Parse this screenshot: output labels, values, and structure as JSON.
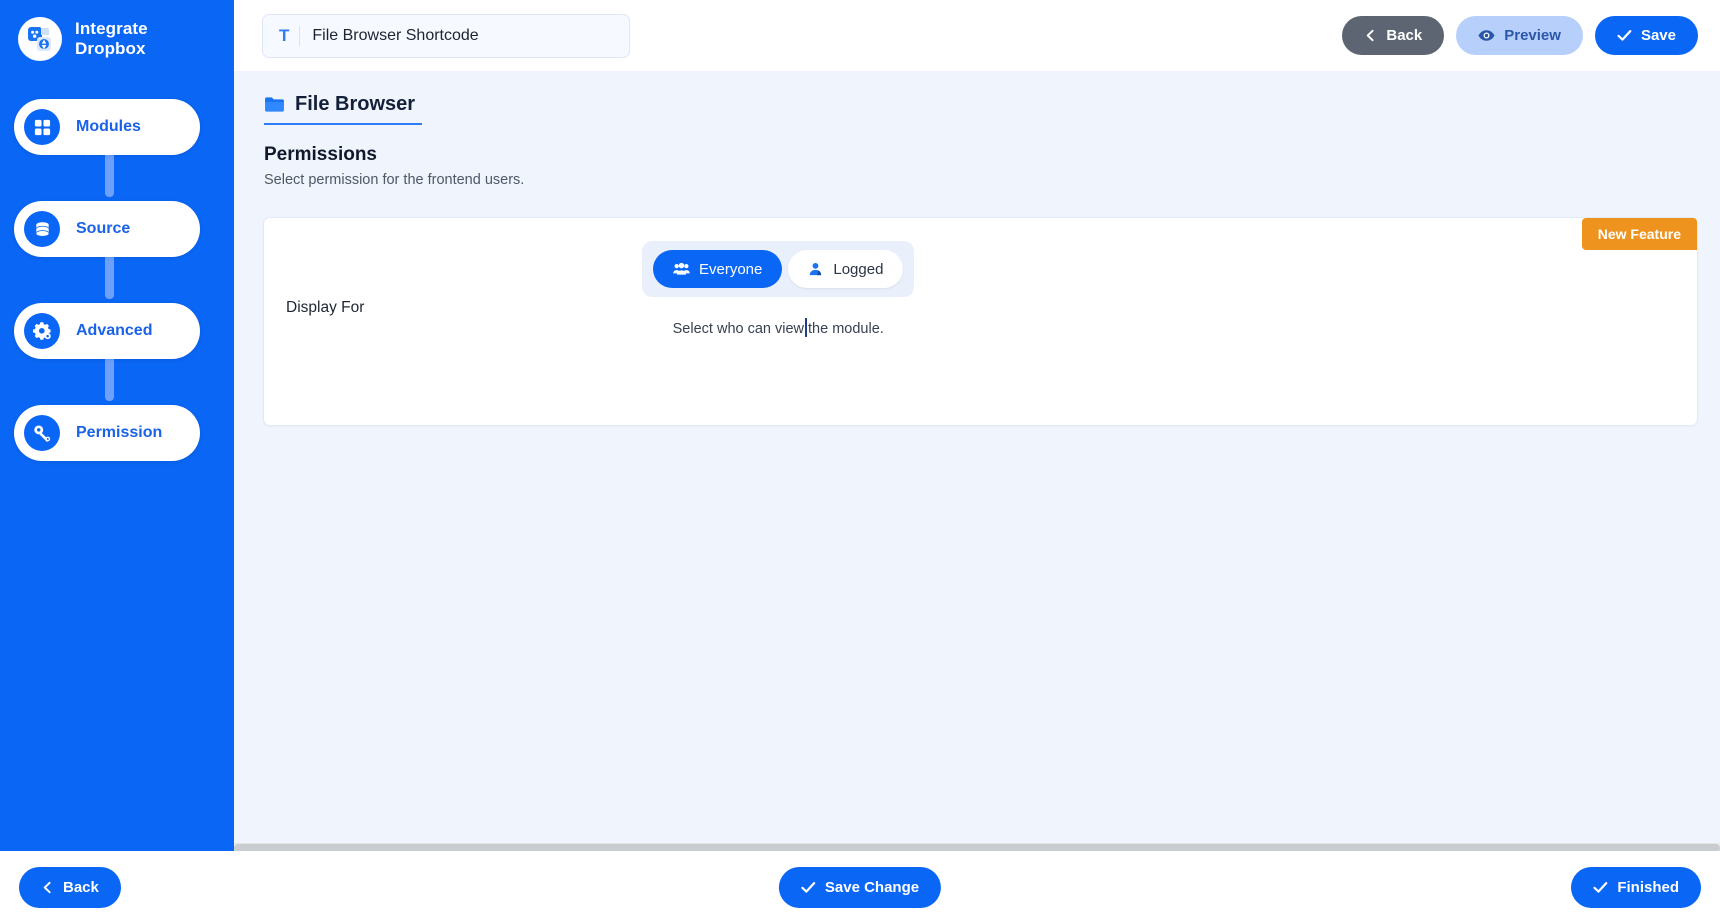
{
  "sidebar": {
    "brand": {
      "line1": "Integrate",
      "line2": "Dropbox",
      "logo_icon": "integrate-dropbox-logo-icon"
    },
    "items": [
      {
        "label": "Modules",
        "icon": "grid-icon"
      },
      {
        "label": "Source",
        "icon": "database-icon"
      },
      {
        "label": "Advanced",
        "icon": "gear-icon"
      },
      {
        "label": "Permission",
        "icon": "key-icon"
      }
    ]
  },
  "topbar": {
    "title_prefix": "T",
    "title_value": "File Browser Shortcode",
    "title_placeholder": "Enter module title",
    "back_label": "Back",
    "preview_label": "Preview",
    "save_label": "Save"
  },
  "content": {
    "breadcrumb": {
      "label": "File Browser",
      "icon": "folder-icon"
    },
    "section_title": "Permissions",
    "section_subtitle": "Select permission for the frontend users.",
    "card": {
      "badge": "New Feature",
      "row_label": "Display For",
      "options": [
        {
          "label": "Everyone",
          "icon": "people-group-icon",
          "selected": true
        },
        {
          "label": "Logged",
          "icon": "user-icon",
          "selected": false
        }
      ],
      "help_before": "Select who can view",
      "help_after": "the module."
    }
  },
  "footer": {
    "back_label": "Back",
    "save_change_label": "Save Change",
    "finished_label": "Finished"
  },
  "colors": {
    "brand_blue": "#0a66f5",
    "content_bg": "#f0f4fc",
    "badge_orange": "#ef931f",
    "back_gray": "#5d6472",
    "preview_blue": "#b7d0fb"
  }
}
